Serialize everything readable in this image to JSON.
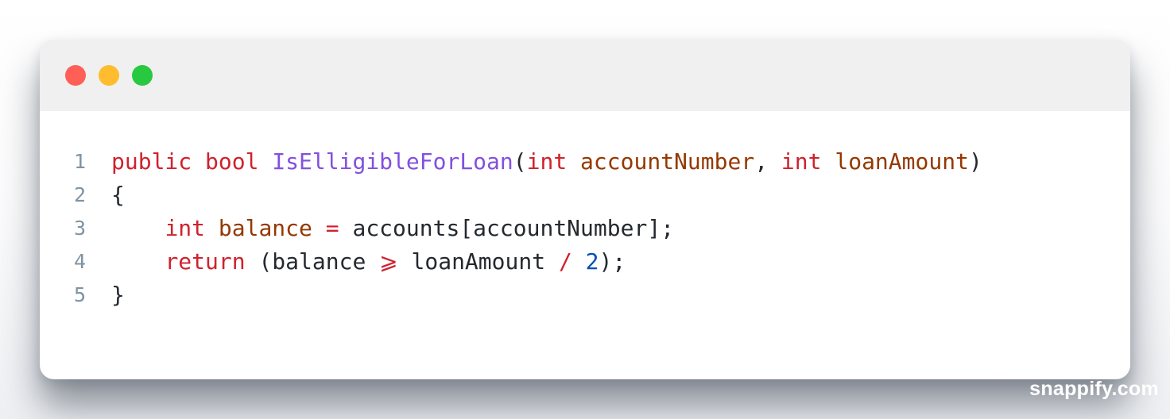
{
  "window": {
    "controls": [
      {
        "name": "close",
        "color": "#ff5f57"
      },
      {
        "name": "minimize",
        "color": "#febc2e"
      },
      {
        "name": "zoom",
        "color": "#28c840"
      }
    ]
  },
  "code": {
    "language": "csharp",
    "lines": [
      {
        "number": "1",
        "tokens": [
          {
            "text": "public",
            "type": "keyword"
          },
          {
            "text": " ",
            "type": "plain"
          },
          {
            "text": "bool",
            "type": "keyword"
          },
          {
            "text": " ",
            "type": "plain"
          },
          {
            "text": "IsElligibleForLoan",
            "type": "function"
          },
          {
            "text": "(",
            "type": "plain"
          },
          {
            "text": "int",
            "type": "keyword"
          },
          {
            "text": " ",
            "type": "plain"
          },
          {
            "text": "accountNumber",
            "type": "parameter"
          },
          {
            "text": ", ",
            "type": "plain"
          },
          {
            "text": "int",
            "type": "keyword"
          },
          {
            "text": " ",
            "type": "plain"
          },
          {
            "text": "loanAmount",
            "type": "parameter"
          },
          {
            "text": ")",
            "type": "plain"
          }
        ]
      },
      {
        "number": "2",
        "tokens": [
          {
            "text": "{",
            "type": "plain"
          }
        ]
      },
      {
        "number": "3",
        "tokens": [
          {
            "text": "    ",
            "type": "plain"
          },
          {
            "text": "int",
            "type": "keyword"
          },
          {
            "text": " ",
            "type": "plain"
          },
          {
            "text": "balance",
            "type": "parameter"
          },
          {
            "text": " ",
            "type": "plain"
          },
          {
            "text": "=",
            "type": "operator"
          },
          {
            "text": " accounts[accountNumber];",
            "type": "plain"
          }
        ]
      },
      {
        "number": "4",
        "tokens": [
          {
            "text": "    ",
            "type": "plain"
          },
          {
            "text": "return",
            "type": "keyword"
          },
          {
            "text": " (balance ",
            "type": "plain"
          },
          {
            "text": "⩾",
            "type": "operator"
          },
          {
            "text": " loanAmount ",
            "type": "plain"
          },
          {
            "text": "/",
            "type": "operator"
          },
          {
            "text": " ",
            "type": "plain"
          },
          {
            "text": "2",
            "type": "number"
          },
          {
            "text": ");",
            "type": "plain"
          }
        ]
      },
      {
        "number": "5",
        "tokens": [
          {
            "text": "}",
            "type": "plain"
          }
        ]
      }
    ]
  },
  "watermark": "snappify.com"
}
